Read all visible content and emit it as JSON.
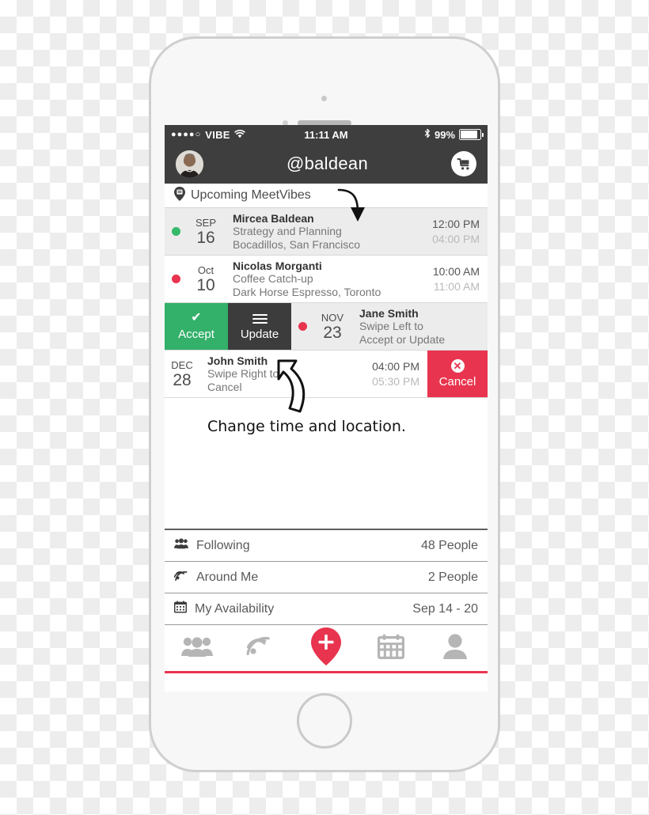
{
  "status_bar": {
    "signal_dots": "●●●●○",
    "carrier": "VIBE",
    "wifi_icon": "wifi-icon",
    "time": "11:11 AM",
    "bluetooth_icon": "bluetooth-icon",
    "battery_percent": "99%"
  },
  "header": {
    "avatar_icon": "user-avatar",
    "title": "@baldean",
    "cart_icon": "shopping-cart-icon"
  },
  "section": {
    "pin_icon": "location-pin-icon",
    "title": "Upcoming MeetVibes"
  },
  "events": [
    {
      "status_color": "#35b96a",
      "month": "SEP",
      "day": "16",
      "name": "Mircea Baldean",
      "subject": "Strategy and Planning",
      "location": "Bocadillos, San Francisco",
      "start_time": "12:00 PM",
      "end_time": "04:00 PM"
    },
    {
      "status_color": "#e8344e",
      "month": "Oct",
      "day": "10",
      "name": "Nicolas Morganti",
      "subject": "Coffee Catch-up",
      "location": "Dark Horse Espresso, Toronto",
      "start_time": "10:00 AM",
      "end_time": "11:00 AM"
    },
    {
      "status_color": "#e8344e",
      "month": "NOV",
      "day": "23",
      "name": "Jane Smith",
      "subject": "Swipe Left to",
      "location": "Accept or Update",
      "start_time": "",
      "end_time": ""
    },
    {
      "status_color": "",
      "month": "DEC",
      "day": "28",
      "name": "John Smith",
      "subject": "Swipe Right to",
      "location": "Cancel",
      "start_time": "04:00 PM",
      "end_time": "05:30 PM"
    }
  ],
  "swipe_actions": {
    "accept_label": "Accept",
    "accept_icon": "checkmark-icon",
    "accept_color": "#33b06a",
    "update_label": "Update",
    "update_icon": "hamburger-menu-icon",
    "update_color": "#3c3c3c",
    "cancel_label": "Cancel",
    "cancel_icon": "circle-x-icon",
    "cancel_color": "#e8344e"
  },
  "list_rows": [
    {
      "icon": "users-group-icon",
      "label": "Following",
      "value": "48 People"
    },
    {
      "icon": "broadcast-signal-icon",
      "label": "Around Me",
      "value": "2 People"
    },
    {
      "icon": "calendar-icon",
      "label": "My Availability",
      "value": "Sep 14 - 20"
    }
  ],
  "tab_bar": {
    "items": [
      {
        "icon": "users-group-icon"
      },
      {
        "icon": "broadcast-signal-icon"
      },
      {
        "icon": "add-pin-icon"
      },
      {
        "icon": "calendar-icon"
      },
      {
        "icon": "profile-person-icon"
      }
    ],
    "accent_color": "#e8344e",
    "inactive_color": "#b5b5b5"
  },
  "annotations": {
    "change_time_note": "Change time and location."
  }
}
